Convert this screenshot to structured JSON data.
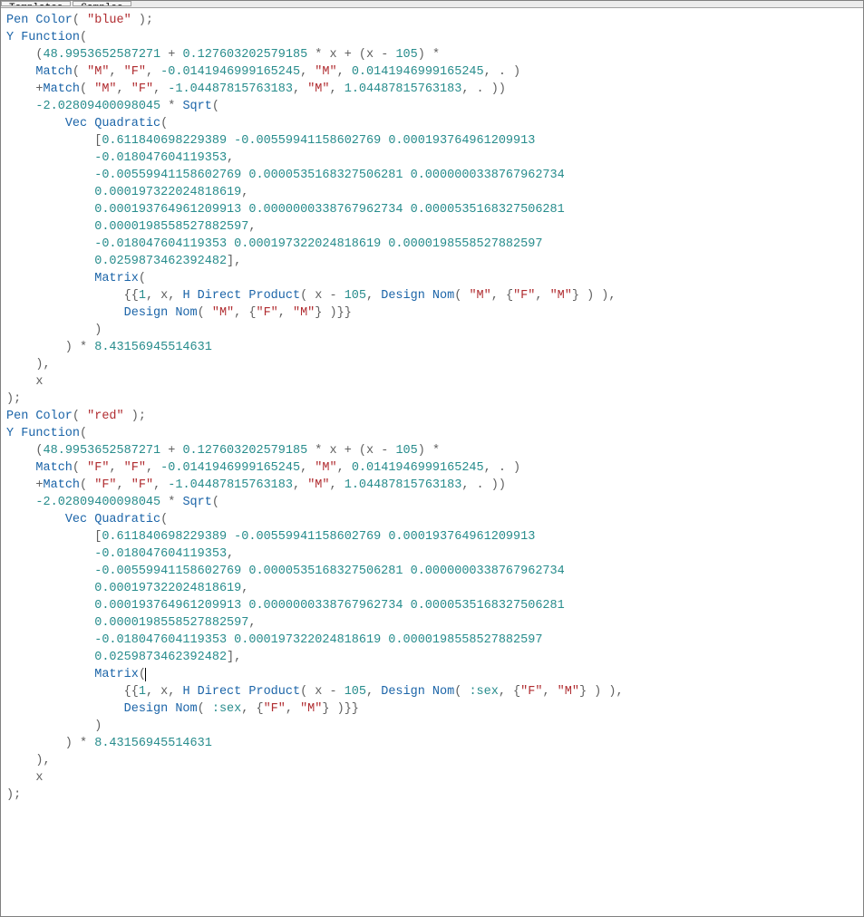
{
  "tabs": {
    "t1": "Templates",
    "t2": "Samples"
  },
  "fn": {
    "pencolor": "Pen Color",
    "yfunction": "Y Function",
    "match": "Match",
    "sqrt": "Sqrt",
    "vecquad": "Vec Quadratic",
    "matrix": "Matrix",
    "hdirect": "H Direct Product",
    "designnom": "Design Nom"
  },
  "str": {
    "blue": "\"blue\"",
    "red": "\"red\"",
    "M": "\"M\"",
    "F": "\"F\""
  },
  "sym": {
    "x": "x",
    "sex": ":sex",
    "one": "1",
    "dot": "."
  },
  "num": {
    "a": "48.9953652587271",
    "b": "0.127603202579185",
    "c": "105",
    "d": "-0.0141946999165245",
    "e": "0.0141946999165245",
    "f": "-1.04487815763183",
    "g": "1.04487815763183",
    "h": "-2.02809400098045",
    "v0": "0.611840698229389",
    "v1": "-0.00559941158602769",
    "v2": "0.000193764961209913",
    "v3": "-0.018047604119353",
    "v4": "-0.00559941158602769",
    "v5": "0.0000535168327506281",
    "v6": "0.0000000338767962734",
    "v7": "0.000197322024818619",
    "v8": "0.000193764961209913",
    "v9": "0.0000000338767962734",
    "v10": "0.0000535168327506281",
    "v11": "0.0000198558527882597",
    "v12": "-0.018047604119353",
    "v13": "0.000197322024818619",
    "v14": "0.0000198558527882597",
    "v15": "0.0259873462392482",
    "mul": "8.43156945514631"
  }
}
